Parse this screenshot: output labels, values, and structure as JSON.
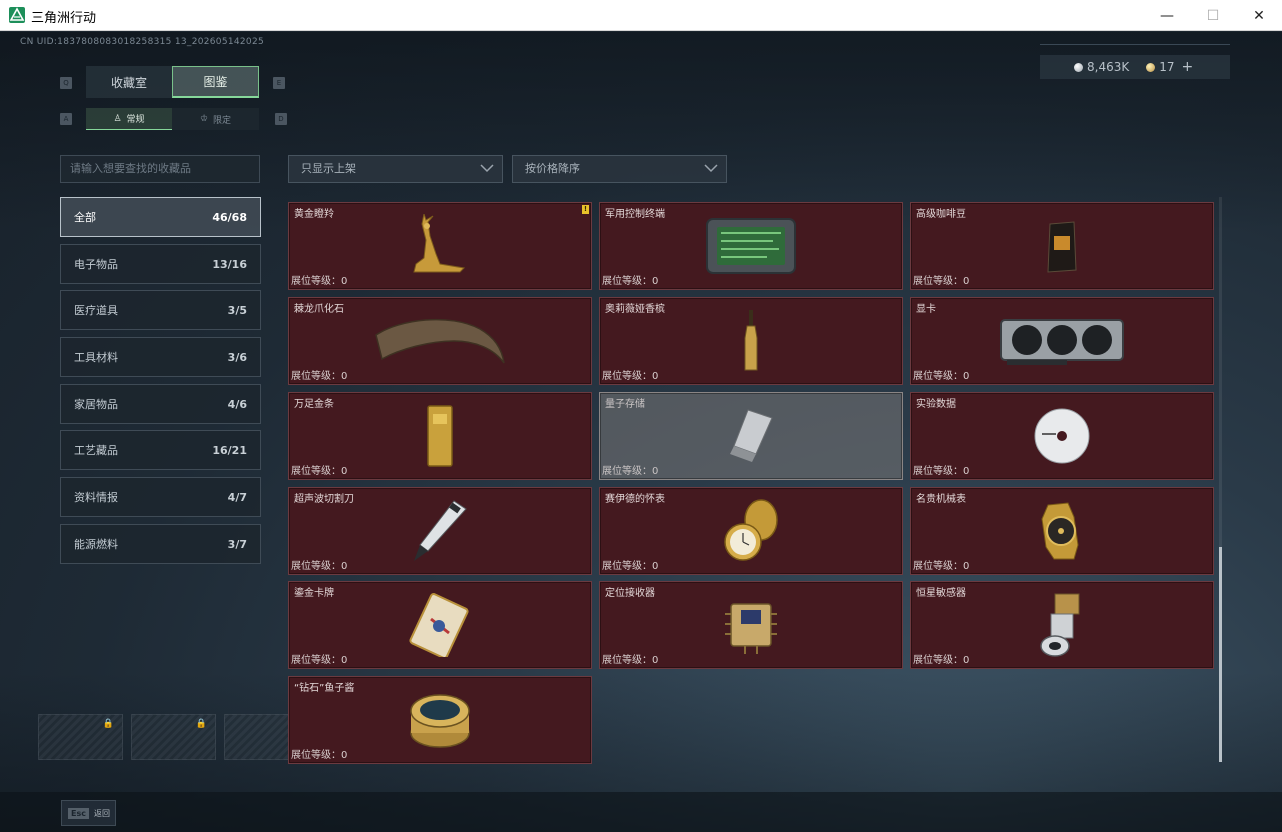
{
  "window": {
    "title": "三角洲行动",
    "minimize": "—",
    "maximize": "☐",
    "close": "✕"
  },
  "uid": "CN UID:1837808083018258315 13_202605142025",
  "currency": {
    "silver": "8,463K",
    "gold": "17",
    "plus": "+"
  },
  "keys": {
    "prev_tab": "Q",
    "next_tab": "E",
    "prev_sub": "A",
    "next_sub": "D"
  },
  "tabs": {
    "collection": "收藏室",
    "album": "图鉴"
  },
  "subtabs": {
    "normal": "常规",
    "limited": "限定"
  },
  "search": {
    "placeholder": "请输入想要查找的收藏品"
  },
  "filters": {
    "shelf": "只显示上架",
    "sort": "按价格降序"
  },
  "categories": [
    {
      "label": "全部",
      "count": "46/68"
    },
    {
      "label": "电子物品",
      "count": "13/16"
    },
    {
      "label": "医疗道具",
      "count": "3/5"
    },
    {
      "label": "工具材料",
      "count": "3/6"
    },
    {
      "label": "家居物品",
      "count": "4/6"
    },
    {
      "label": "工艺藏品",
      "count": "16/21"
    },
    {
      "label": "资料情报",
      "count": "4/7"
    },
    {
      "label": "能源燃料",
      "count": "3/7"
    }
  ],
  "items": [
    {
      "name": "黄金瞪羚",
      "level": "展位等级：0",
      "icon": "gazelle-icon",
      "badge": "!"
    },
    {
      "name": "军用控制终端",
      "level": "展位等级：0",
      "icon": "terminal-icon"
    },
    {
      "name": "高级咖啡豆",
      "level": "展位等级：0",
      "icon": "coffee-bag-icon"
    },
    {
      "name": "棘龙爪化石",
      "level": "展位等级：0",
      "icon": "fossil-claw-icon"
    },
    {
      "name": "奥莉薇娅香槟",
      "level": "展位等级：0",
      "icon": "champagne-icon"
    },
    {
      "name": "显卡",
      "level": "展位等级：0",
      "icon": "gpu-icon"
    },
    {
      "name": "万足金条",
      "level": "展位等级：0",
      "icon": "gold-bar-icon"
    },
    {
      "name": "量子存储",
      "level": "展位等级：0",
      "icon": "usb-drive-icon"
    },
    {
      "name": "实验数据",
      "level": "展位等级：0",
      "icon": "disc-icon"
    },
    {
      "name": "超声波切割刀",
      "level": "展位等级：0",
      "icon": "cutter-icon"
    },
    {
      "name": "赛伊德的怀表",
      "level": "展位等级：0",
      "icon": "pocket-watch-icon"
    },
    {
      "name": "名贵机械表",
      "level": "展位等级：0",
      "icon": "wristwatch-icon"
    },
    {
      "name": "鎏金卡牌",
      "level": "展位等级：0",
      "icon": "card-icon"
    },
    {
      "name": "定位接收器",
      "level": "展位等级：0",
      "icon": "receiver-icon"
    },
    {
      "name": "恒星敏感器",
      "level": "展位等级：0",
      "icon": "star-sensor-icon"
    },
    {
      "name": "“钻石”鱼子酱",
      "level": "展位等级：0",
      "icon": "caviar-tin-icon"
    }
  ],
  "bottom": {
    "esc_key": "Esc",
    "back": "返回"
  },
  "colors": {
    "accent": "#86d89a",
    "card_bg": "#44191f",
    "badge": "#e8c22a"
  }
}
